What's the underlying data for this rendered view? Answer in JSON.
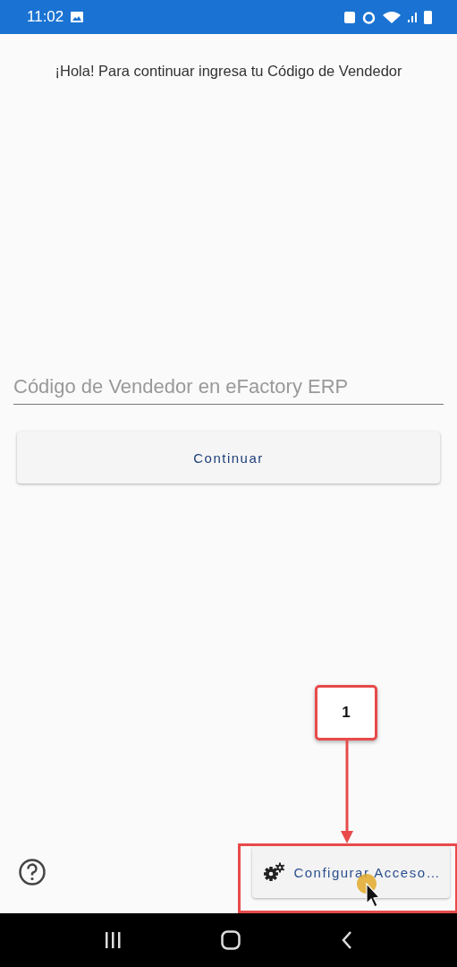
{
  "status_bar": {
    "time": "11:02"
  },
  "greeting": "¡Hola! Para continuar ingresa tu Código de Vendedor",
  "code_field": {
    "placeholder": "Código de Vendedor en eFactory ERP"
  },
  "continue_button": "Continuar",
  "config_button": "Configurar Acceso…",
  "annotation": {
    "label": "1"
  }
}
